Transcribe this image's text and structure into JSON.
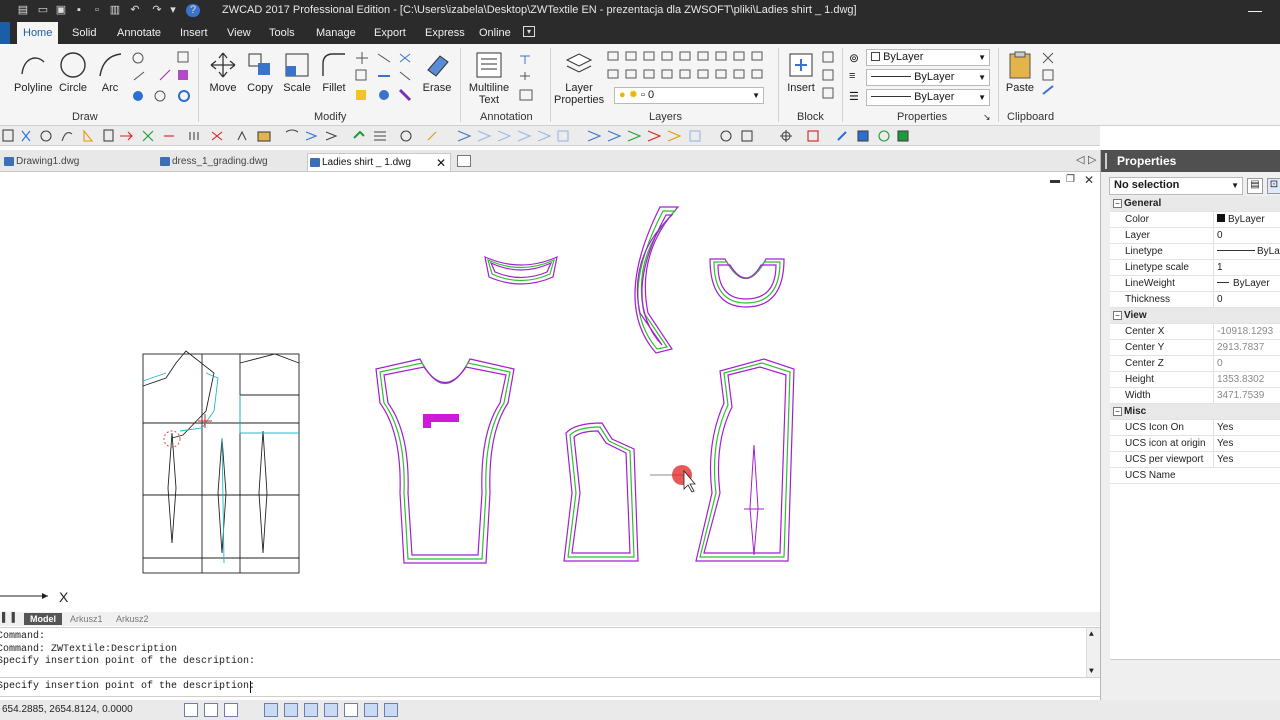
{
  "window": {
    "title": "ZWCAD 2017 Professional Edition - [C:\\Users\\izabela\\Desktop\\ZWTextile EN - prezentacja dla ZWSOFT\\pliki\\Ladies shirt _ 1.dwg]"
  },
  "ribbon": {
    "tabs": [
      "Home",
      "Solid",
      "Annotate",
      "Insert",
      "View",
      "Tools",
      "Manage",
      "Export",
      "Express",
      "Online"
    ],
    "active_tab": "Home",
    "draw": {
      "panel": "Draw",
      "polyline": "Polyline",
      "circle": "Circle",
      "arc": "Arc"
    },
    "modify": {
      "panel": "Modify",
      "move": "Move",
      "copy": "Copy",
      "scale": "Scale",
      "fillet": "Fillet",
      "erase": "Erase"
    },
    "annotation": {
      "panel": "Annotation",
      "mtext_1": "Multiline",
      "mtext_2": "Text"
    },
    "layers": {
      "panel": "Layers",
      "layer_props_1": "Layer",
      "layer_props_2": "Properties",
      "current_layer": "0"
    },
    "block": {
      "panel": "Block",
      "insert": "Insert"
    },
    "properties": {
      "panel": "Properties",
      "color": "ByLayer",
      "linetype": "ByLayer",
      "lineweight": "ByLayer"
    },
    "clipboard": {
      "panel": "Clipboard",
      "paste": "Paste"
    }
  },
  "doc_tabs": [
    {
      "label": "Drawing1.dwg"
    },
    {
      "label": "dress_1_grading.dwg"
    },
    {
      "label": "Ladies shirt _ 1.dwg"
    }
  ],
  "layout_tabs": [
    "Model",
    "Arkusz1",
    "Arkusz2"
  ],
  "command": {
    "history": [
      "Command:",
      "Command: ZWTextile:Description",
      "Specify insertion point of the description:"
    ],
    "prompt": "Specify insertion point of the description:"
  },
  "status": {
    "coords": "654.2885, 2654.8124, 0.0000"
  },
  "axis_label": "X",
  "properties_panel": {
    "title": "Properties",
    "selection": "No selection",
    "groups": [
      {
        "name": "General",
        "rows": [
          {
            "k": "Color",
            "v": "ByLayer"
          },
          {
            "k": "Layer",
            "v": "0"
          },
          {
            "k": "Linetype",
            "v": "ByLayer"
          },
          {
            "k": "Linetype scale",
            "v": "1"
          },
          {
            "k": "LineWeight",
            "v": "ByLayer"
          },
          {
            "k": "Thickness",
            "v": "0"
          }
        ]
      },
      {
        "name": "View",
        "rows": [
          {
            "k": "Center X",
            "v": "-10918.1293"
          },
          {
            "k": "Center Y",
            "v": "2913.7837"
          },
          {
            "k": "Center Z",
            "v": "0"
          },
          {
            "k": "Height",
            "v": "1353.8302"
          },
          {
            "k": "Width",
            "v": "3471.7539"
          }
        ]
      },
      {
        "name": "Misc",
        "rows": [
          {
            "k": "UCS Icon On",
            "v": "Yes"
          },
          {
            "k": "UCS icon at origin",
            "v": "Yes"
          },
          {
            "k": "UCS per viewport",
            "v": "Yes"
          },
          {
            "k": "UCS Name",
            "v": ""
          }
        ]
      }
    ]
  },
  "colors": {
    "accent": "#1b5ea8",
    "pattern_green": "#2fbf2f",
    "pattern_purple": "#a21fd0",
    "cursor_red": "#e02020"
  }
}
